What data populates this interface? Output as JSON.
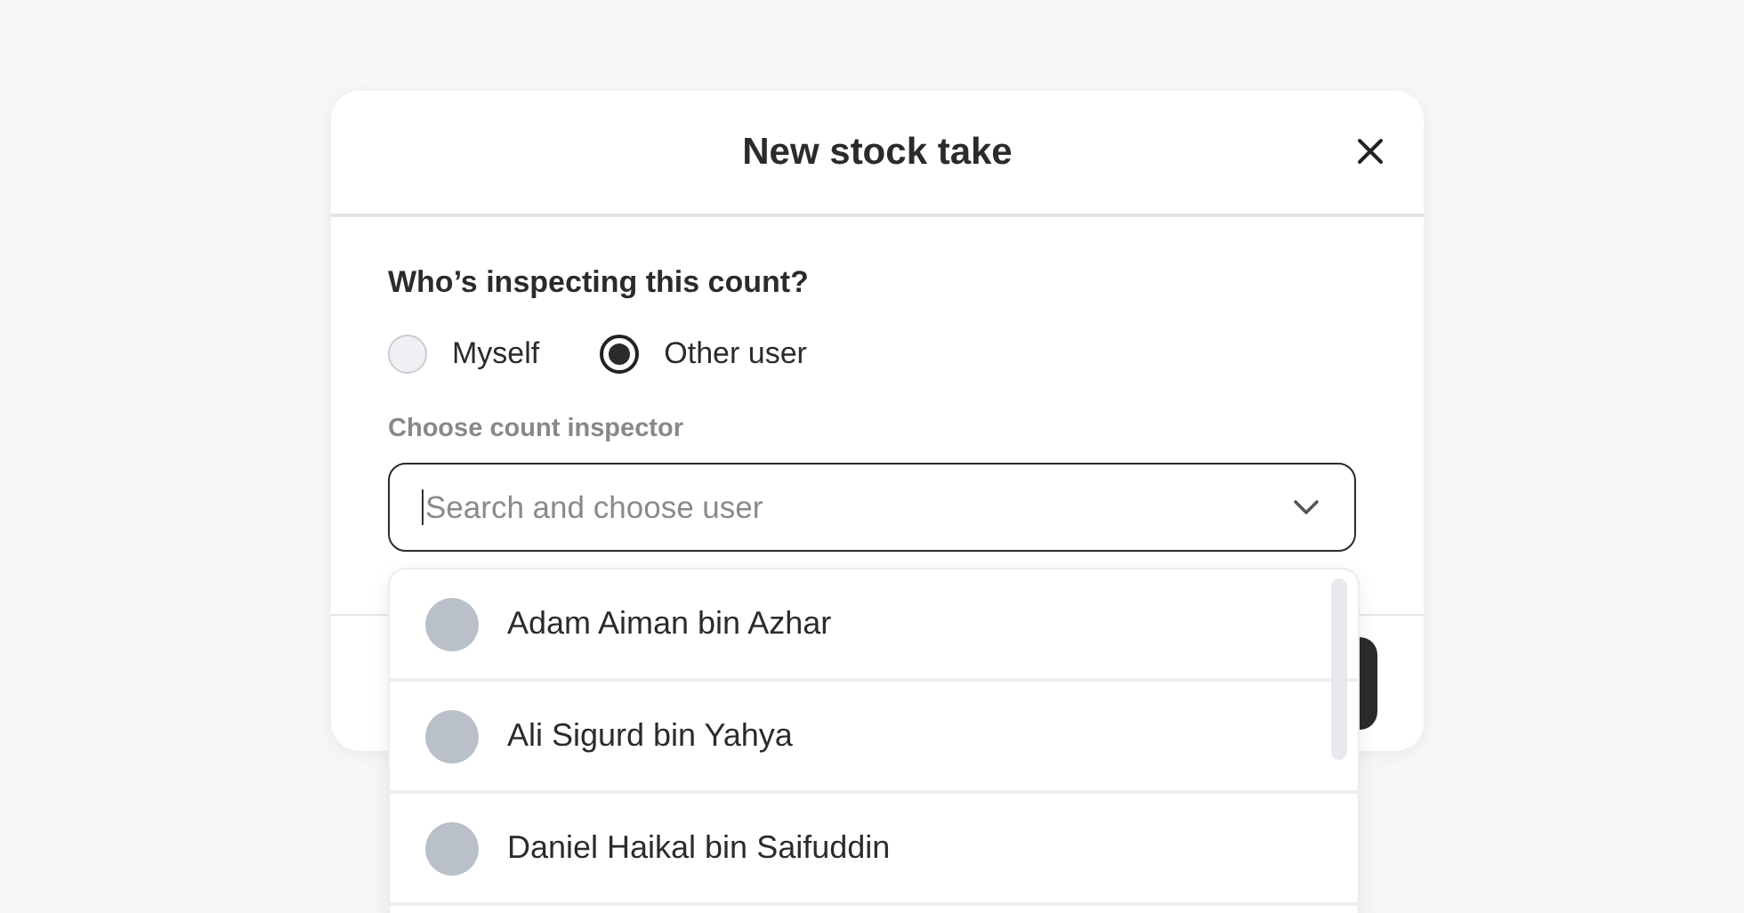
{
  "dialog": {
    "title": "New stock take",
    "question": "Who’s inspecting this count?",
    "options": [
      {
        "label": "Myself",
        "selected": false
      },
      {
        "label": "Other user",
        "selected": true
      }
    ],
    "field_label": "Choose count inspector",
    "search": {
      "placeholder": "Search and choose user"
    },
    "users": [
      {
        "name": "Adam Aiman bin Azhar"
      },
      {
        "name": "Ali Sigurd bin Yahya"
      },
      {
        "name": "Daniel Haikal bin Saifuddin"
      }
    ]
  }
}
